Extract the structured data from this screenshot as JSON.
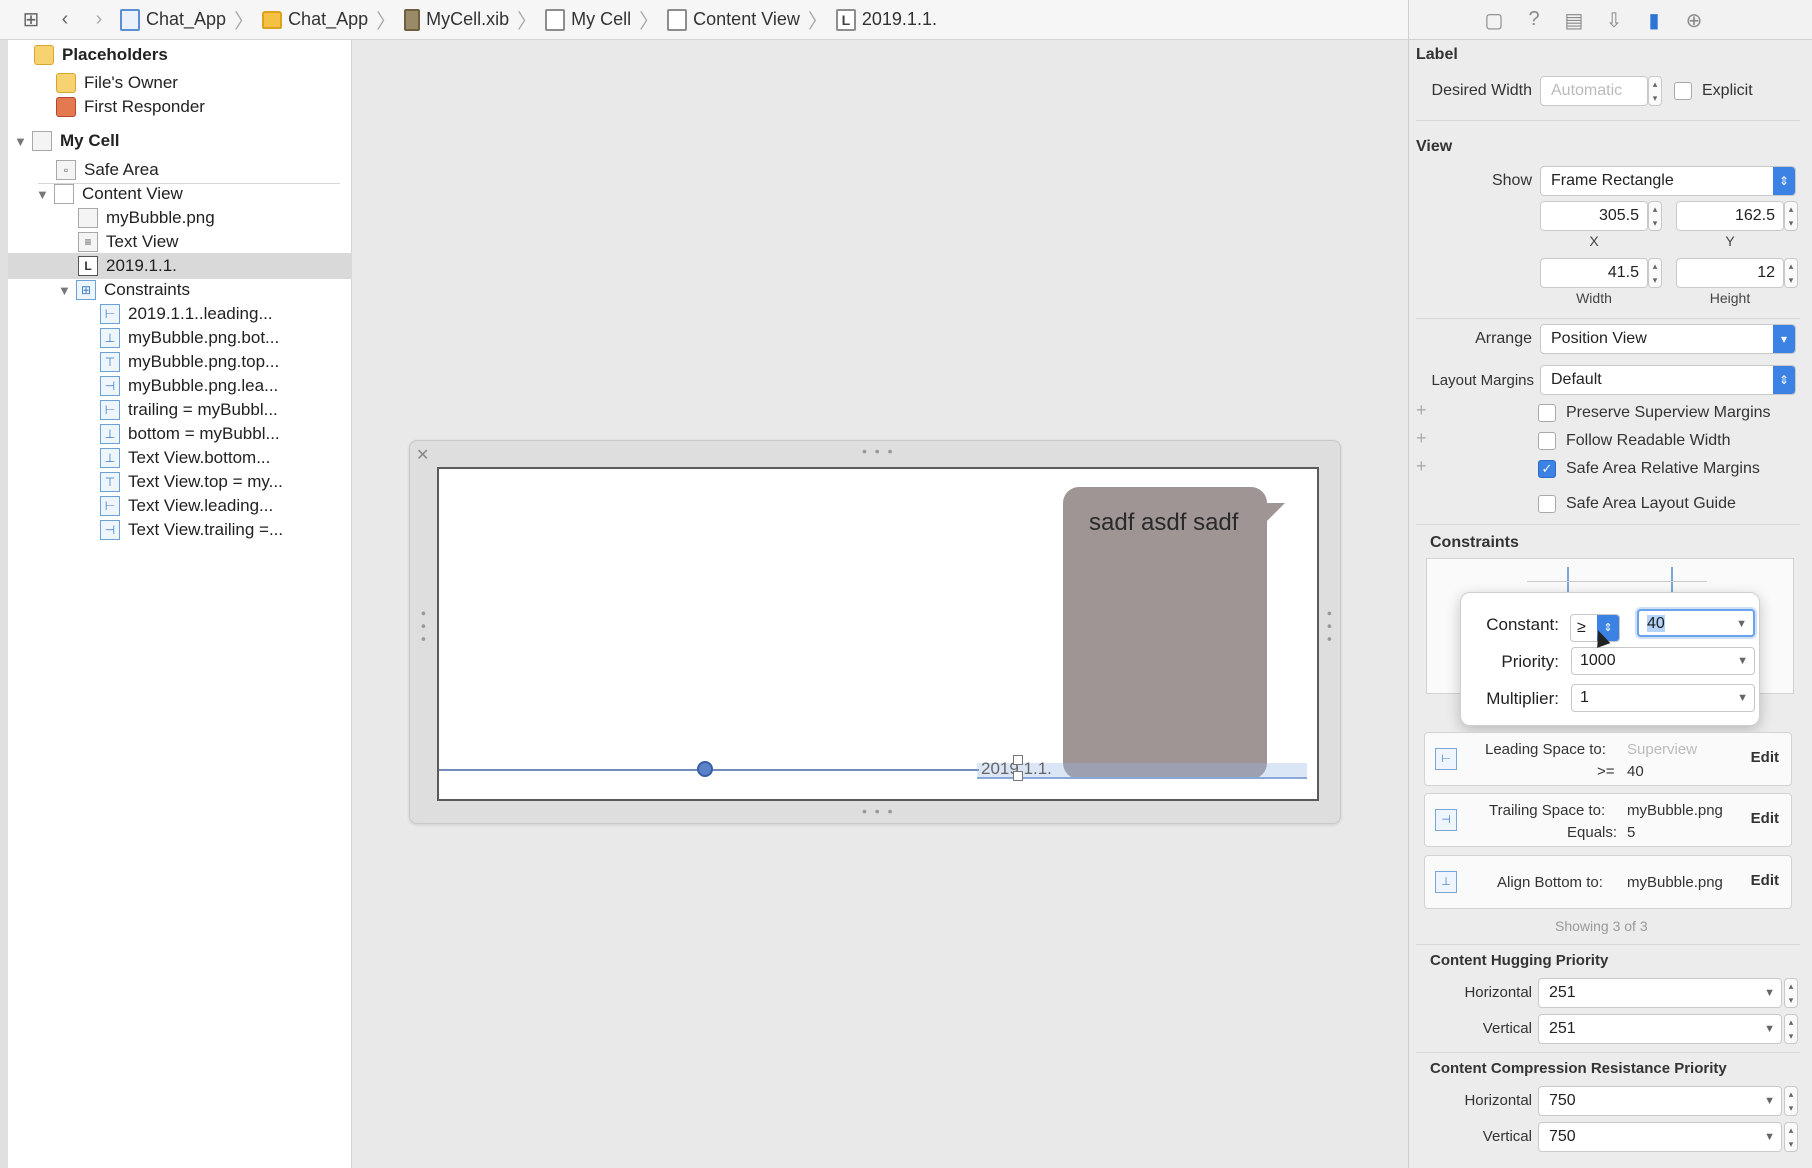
{
  "breadcrumb": {
    "items": [
      "Chat_App",
      "Chat_App",
      "MyCell.xib",
      "My Cell",
      "Content View",
      "2019.1.1."
    ]
  },
  "outline": {
    "placeholders": "Placeholders",
    "files_owner": "File's Owner",
    "first_responder": "First Responder",
    "my_cell": "My Cell",
    "safe_area": "Safe Area",
    "content_view": "Content View",
    "my_bubble": "myBubble.png",
    "text_view": "Text View",
    "date_label": "2019.1.1.",
    "constraints": "Constraints",
    "constraint_items": [
      "2019.1.1..leading...",
      "myBubble.png.bot...",
      "myBubble.png.top...",
      "myBubble.png.lea...",
      "trailing = myBubbl...",
      "bottom = myBubbl...",
      "Text View.bottom...",
      "Text View.top = my...",
      "Text View.leading...",
      "Text View.trailing =..."
    ]
  },
  "canvas": {
    "bubble_text": "sadf asdf sadf",
    "date_text": "2019.1.1."
  },
  "inspector": {
    "label_section": "Label",
    "desired_width_label": "Desired Width",
    "desired_width_value": "Automatic",
    "explicit_label": "Explicit",
    "view_section": "View",
    "show_label": "Show",
    "show_value": "Frame Rectangle",
    "x_value": "305.5",
    "y_value": "162.5",
    "x_label": "X",
    "y_label": "Y",
    "width_value": "41.5",
    "height_value": "12",
    "width_label": "Width",
    "height_label": "Height",
    "arrange_label": "Arrange",
    "arrange_value": "Position View",
    "layout_margins_label": "Layout Margins",
    "layout_margins_value": "Default",
    "preserve_superview": "Preserve Superview Margins",
    "follow_readable": "Follow Readable Width",
    "safe_area_relative": "Safe Area Relative Margins",
    "safe_area_guide": "Safe Area Layout Guide",
    "constraints_section": "Constraints",
    "popover": {
      "constant_label": "Constant:",
      "relation": "≥",
      "constant_value": "40",
      "priority_label": "Priority:",
      "priority_value": "1000",
      "multiplier_label": "Multiplier:",
      "multiplier_value": "1"
    },
    "constraint_cards": [
      {
        "line1_key": "Leading Space to:",
        "line1_val": "Superview",
        "line2_key": ">=",
        "line2_val": "40",
        "edit": "Edit"
      },
      {
        "line1_key": "Trailing Space to:",
        "line1_val": "myBubble.png",
        "line2_key": "Equals:",
        "line2_val": "5",
        "edit": "Edit"
      },
      {
        "line1_key": "Align Bottom to:",
        "line1_val": "myBubble.png",
        "edit": "Edit"
      }
    ],
    "showing": "Showing 3 of 3",
    "hugging_section": "Content Hugging Priority",
    "hugging_horizontal_label": "Horizontal",
    "hugging_horizontal_value": "251",
    "hugging_vertical_label": "Vertical",
    "hugging_vertical_value": "251",
    "compression_section": "Content Compression Resistance Priority",
    "compression_horizontal_label": "Horizontal",
    "compression_horizontal_value": "750",
    "compression_vertical_label": "Vertical",
    "compression_vertical_value": "750"
  }
}
